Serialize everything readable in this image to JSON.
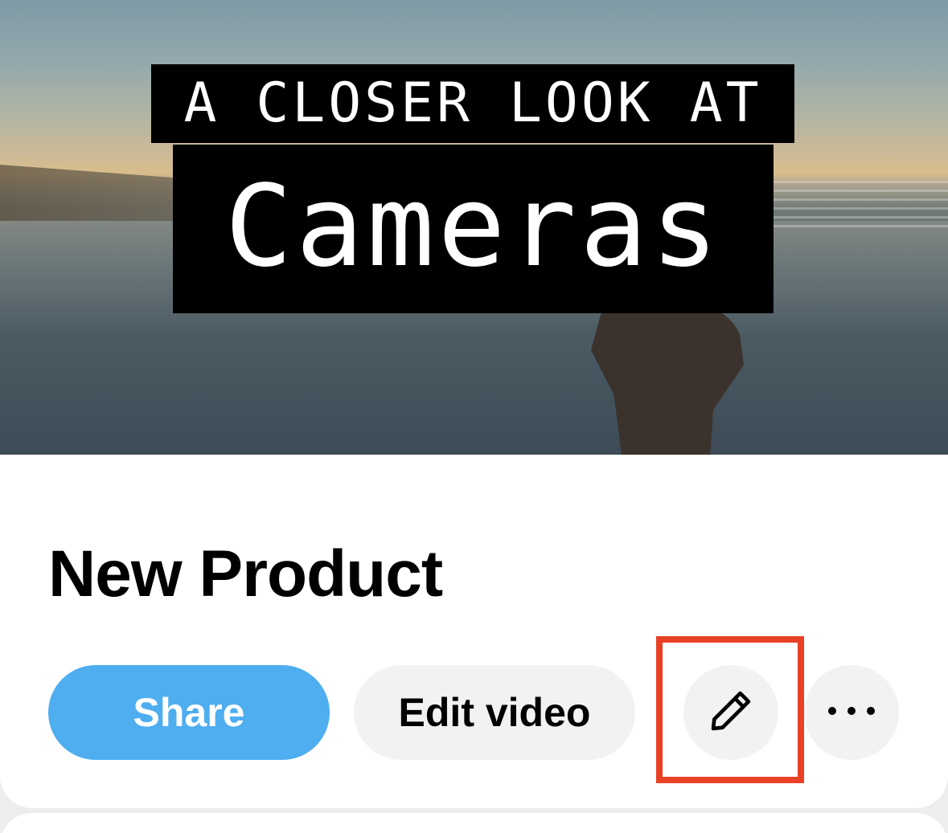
{
  "video": {
    "thumbnail": {
      "caption_top": "A CLOSER LOOK AT",
      "caption_main": "Cameras"
    },
    "title": "New Product"
  },
  "actions": {
    "share_label": "Share",
    "edit_video_label": "Edit video",
    "edit_details_icon": "pencil-icon",
    "more_icon": "more-horizontal-icon"
  },
  "colors": {
    "share_button": "#4eaef0",
    "secondary_button": "#f2f2f2",
    "highlight": "#e84125"
  }
}
